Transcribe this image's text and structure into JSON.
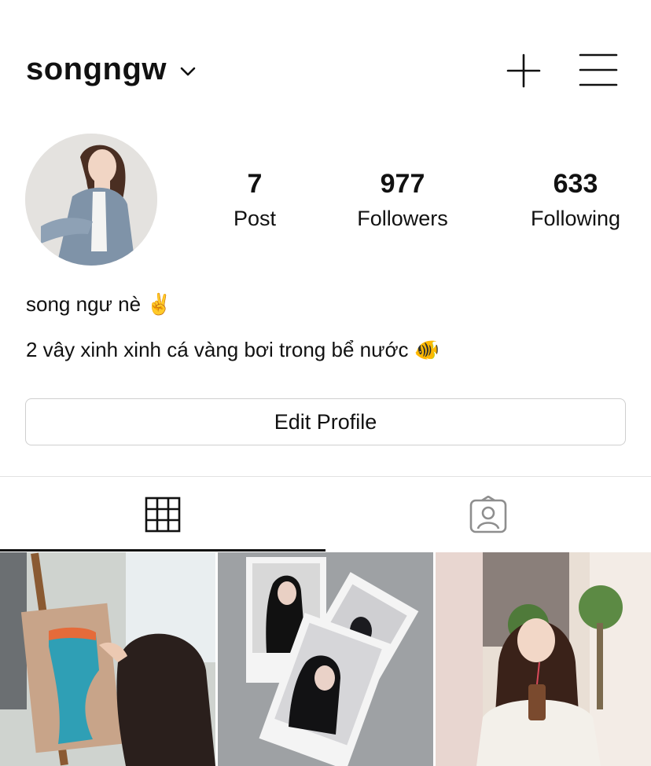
{
  "header": {
    "username": "songngw"
  },
  "stats": {
    "posts": {
      "value": "7",
      "label": "Post"
    },
    "followers": {
      "value": "977",
      "label": "Followers"
    },
    "following": {
      "value": "633",
      "label": "Following"
    }
  },
  "bio": {
    "name": "song ngư nè ✌️",
    "text": "2 vây xinh xinh cá vàng bơi trong bể nước 🐠"
  },
  "actions": {
    "edit_profile": "Edit Profile"
  },
  "tabs": [
    {
      "icon": "grid-icon",
      "active": true
    },
    {
      "icon": "tagged-user-icon",
      "active": false
    }
  ],
  "colors": {
    "text": "#111111",
    "border": "#cfcfcf",
    "divider": "#e2e2e2",
    "inactive_icon": "#8e8e8e"
  }
}
